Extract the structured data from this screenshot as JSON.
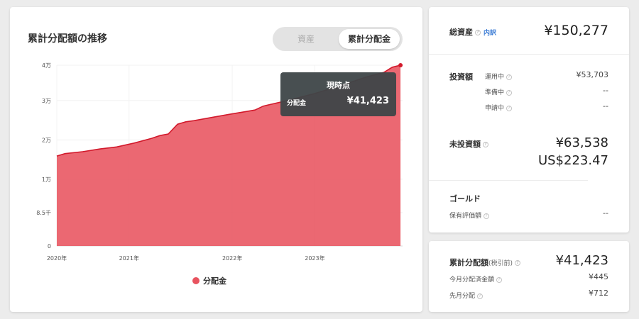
{
  "chart_panel": {
    "title": "累計分配額の推移",
    "toggle": {
      "option_assets": "資産",
      "option_distribution": "累計分配金"
    },
    "tooltip": {
      "title": "現時点",
      "label": "分配金",
      "value": "¥41,423"
    },
    "legend": {
      "label": "分配金",
      "color": "#e8535f"
    }
  },
  "chart_data": {
    "type": "area",
    "title": "累計分配額の推移",
    "xlabel": "",
    "ylabel": "",
    "y_ticks": [
      {
        "value": 0,
        "label": "0"
      },
      {
        "value": 8500,
        "label": "8.5千"
      },
      {
        "value": 17000,
        "label": "1万"
      },
      {
        "value": 27000,
        "label": "2万"
      },
      {
        "value": 37000,
        "label": "3万"
      },
      {
        "value": 46000,
        "label": "4万"
      }
    ],
    "x_ticks": [
      {
        "value": 2020.0,
        "label": "2020年"
      },
      {
        "value": 2020.7,
        "label": "2021年"
      },
      {
        "value": 2021.7,
        "label": "2022年"
      },
      {
        "value": 2022.5,
        "label": "2023年"
      }
    ],
    "xlim": [
      2020.0,
      2023.35
    ],
    "ylim": [
      0,
      46000
    ],
    "series": [
      {
        "name": "分配金",
        "color": "#e8535f",
        "x": [
          2020.0,
          2020.08,
          2020.25,
          2020.42,
          2020.58,
          2020.75,
          2020.92,
          2021.0,
          2021.08,
          2021.17,
          2021.25,
          2021.33,
          2021.5,
          2021.67,
          2021.83,
          2021.92,
          2022.0,
          2022.25,
          2022.5,
          2022.75,
          2023.0,
          2023.17,
          2023.25,
          2023.33
        ],
        "values": [
          22900,
          23500,
          24000,
          24700,
          25200,
          26200,
          27400,
          28100,
          28500,
          31000,
          31600,
          31900,
          32700,
          33500,
          34200,
          34600,
          35600,
          37100,
          38800,
          40800,
          43000,
          44200,
          45500,
          46000
        ]
      }
    ],
    "grid": true,
    "legend_position": "bottom-center"
  },
  "assets": {
    "total_label": "総資産",
    "breakdown_link": "内訳",
    "total_value": "¥150,277",
    "invested_label": "投資額",
    "invested_rows": [
      {
        "label": "運用中",
        "value": "¥53,703"
      },
      {
        "label": "準備中",
        "value": "--"
      },
      {
        "label": "申請中",
        "value": "--"
      }
    ],
    "uninvested_label": "未投資額",
    "uninvested_jpy": "¥63,538",
    "uninvested_usd": "US$223.47",
    "gold_label": "ゴールド",
    "gold_row": {
      "label": "保有評価額",
      "value": "--"
    }
  },
  "distribution": {
    "cumulative_label": "累計分配額",
    "cumulative_note": "(税引前)",
    "cumulative_value": "¥41,423",
    "this_month_label": "今月分配済金額",
    "this_month_value": "¥445",
    "last_month_label": "先月分配",
    "last_month_value": "¥712"
  }
}
